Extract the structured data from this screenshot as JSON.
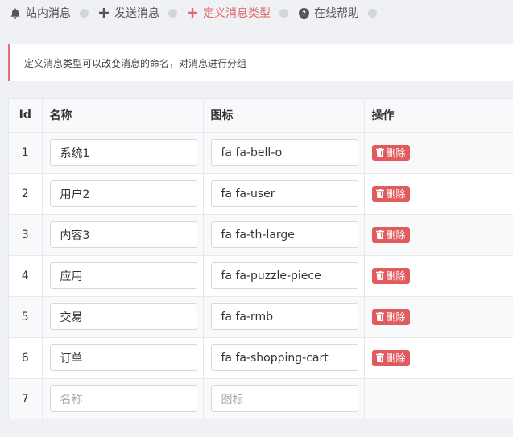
{
  "nav": {
    "items": [
      {
        "label": "站内消息",
        "icon": "bell-icon"
      },
      {
        "label": "发送消息",
        "icon": "plus-icon"
      },
      {
        "label": "定义消息类型",
        "icon": "plus-icon",
        "active": true
      },
      {
        "label": "在线帮助",
        "icon": "question-circle-icon"
      }
    ]
  },
  "alert": {
    "text": "定义消息类型可以改变消息的命名，对消息进行分组"
  },
  "table": {
    "headers": {
      "id": "Id",
      "name": "名称",
      "icon": "图标",
      "actions": "操作"
    },
    "rows": [
      {
        "id": "1",
        "name": "系统1",
        "icon": "fa fa-bell-o",
        "action": "删除"
      },
      {
        "id": "2",
        "name": "用户2",
        "icon": "fa fa-user",
        "action": "删除"
      },
      {
        "id": "3",
        "name": "内容3",
        "icon": "fa fa-th-large",
        "action": "删除"
      },
      {
        "id": "4",
        "name": "应用",
        "icon": "fa fa-puzzle-piece",
        "action": "删除"
      },
      {
        "id": "5",
        "name": "交易",
        "icon": "fa fa-rmb",
        "action": "删除"
      },
      {
        "id": "6",
        "name": "订单",
        "icon": "fa fa-shopping-cart",
        "action": "删除"
      }
    ],
    "new_row": {
      "id": "7",
      "name_placeholder": "名称",
      "icon_placeholder": "图标"
    }
  },
  "colors": {
    "accent": "#e0666a",
    "danger": "#e05a5e",
    "alert_border": "#e2707a"
  }
}
